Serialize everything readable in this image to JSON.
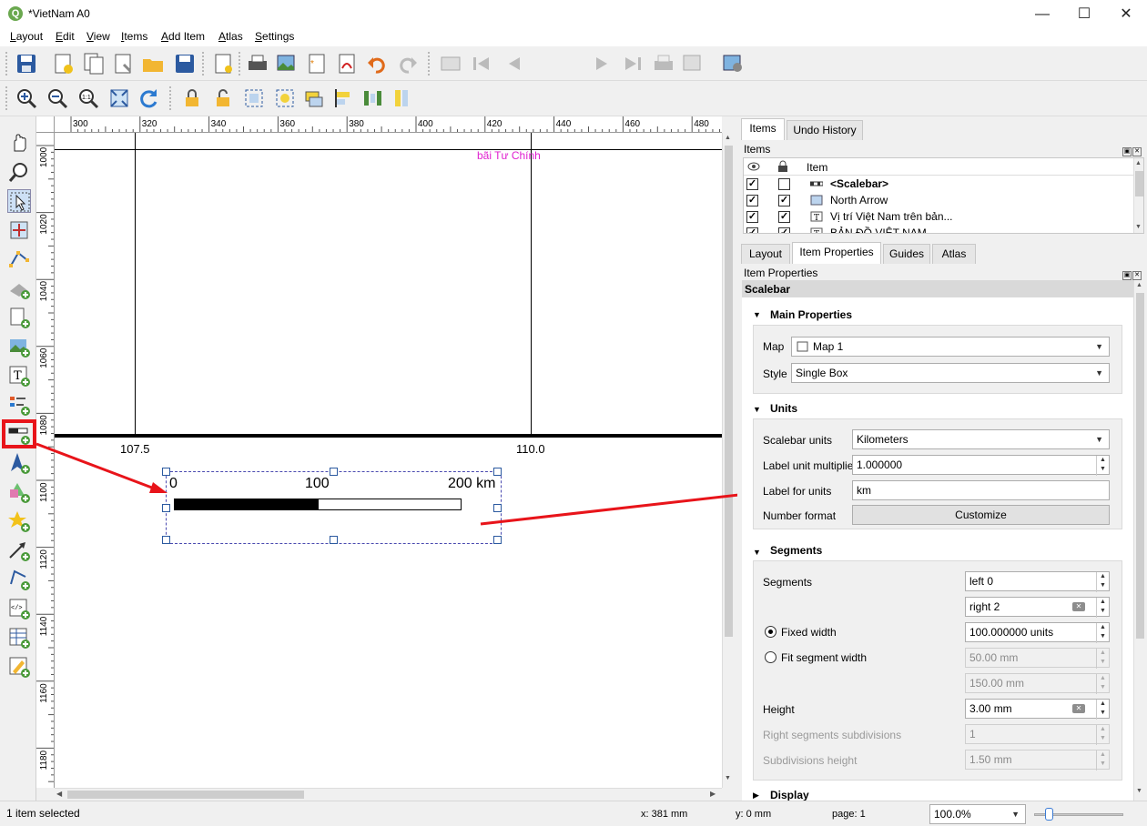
{
  "window": {
    "title": "*VietNam A0",
    "logo_letter": "Q"
  },
  "menu": [
    {
      "label": "Layout",
      "u": "L"
    },
    {
      "label": "Edit",
      "u": "E"
    },
    {
      "label": "View",
      "u": "V"
    },
    {
      "label": "Items",
      "u": "I"
    },
    {
      "label": "Add Item",
      "u": "A"
    },
    {
      "label": "Atlas",
      "u": "A"
    },
    {
      "label": "Settings",
      "u": "S"
    }
  ],
  "toolbar": {
    "page_number": "1"
  },
  "rulers": {
    "horizontal": [
      "300",
      "320",
      "340",
      "360",
      "380",
      "400",
      "420",
      "440",
      "460",
      "480"
    ],
    "vertical": [
      "1000",
      "1020",
      "1040",
      "1060",
      "1080",
      "1100",
      "1120",
      "1140",
      "1160",
      "1180"
    ]
  },
  "canvas": {
    "label_pink": "bãi Tư Chính",
    "grid_label_left": "107.5",
    "grid_label_right": "110.0",
    "scalebar_labels": [
      "0",
      "100",
      "200 km"
    ]
  },
  "dock": {
    "top_tabs": [
      "Items",
      "Undo History"
    ],
    "items_panel_title": "Items",
    "items_header": "Item",
    "items": [
      {
        "name": "<Scalebar>",
        "visible": true,
        "locked": false,
        "bold": true,
        "icon": "scalebar-icon"
      },
      {
        "name": "North Arrow",
        "visible": true,
        "locked": true,
        "bold": false,
        "icon": "picture-icon"
      },
      {
        "name": "Vị trí Việt Nam trên bản...",
        "visible": true,
        "locked": true,
        "bold": false,
        "icon": "text-icon"
      },
      {
        "name": "BẢN ĐỒ VIỆT NAM",
        "visible": true,
        "locked": true,
        "bold": false,
        "icon": "text-icon"
      }
    ],
    "prop_tabs": [
      "Layout",
      "Item Properties",
      "Guides",
      "Atlas"
    ],
    "props_panel_title": "Item Properties",
    "item_type": "Scalebar"
  },
  "props": {
    "main": {
      "title": "Main Properties",
      "map_label": "Map",
      "map_value": "Map 1",
      "style_label": "Style",
      "style_value": "Single Box"
    },
    "units": {
      "title": "Units",
      "scalebar_units_label": "Scalebar units",
      "scalebar_units_value": "Kilometers",
      "multiplier_label": "Label unit multiplier",
      "multiplier_value": "1.000000",
      "label_units_label": "Label for units",
      "label_units_value": "km",
      "number_format_label": "Number format",
      "customize_label": "Customize"
    },
    "segments": {
      "title": "Segments",
      "segments_label": "Segments",
      "left_value": "left 0",
      "right_value": "right 2",
      "fixed_width_label": "Fixed width",
      "fixed_width_value": "100.000000 units",
      "fit_label": "Fit segment width",
      "fit_min": "50.00 mm",
      "fit_max": "150.00 mm",
      "height_label": "Height",
      "height_value": "3.00 mm",
      "right_subdiv_label": "Right segments subdivisions",
      "right_subdiv_value": "1",
      "subdiv_height_label": "Subdivisions height",
      "subdiv_height_value": "1.50 mm"
    },
    "display": {
      "title": "Display"
    }
  },
  "status": {
    "selected": "1 item selected",
    "x": "x: 381 mm",
    "y": "y: 0 mm",
    "page": "page: 1",
    "zoom": "100.0%"
  },
  "colors": {
    "annotation": "#e8141a",
    "pink_label": "#e020d0",
    "accent": "#3a7bd5"
  }
}
